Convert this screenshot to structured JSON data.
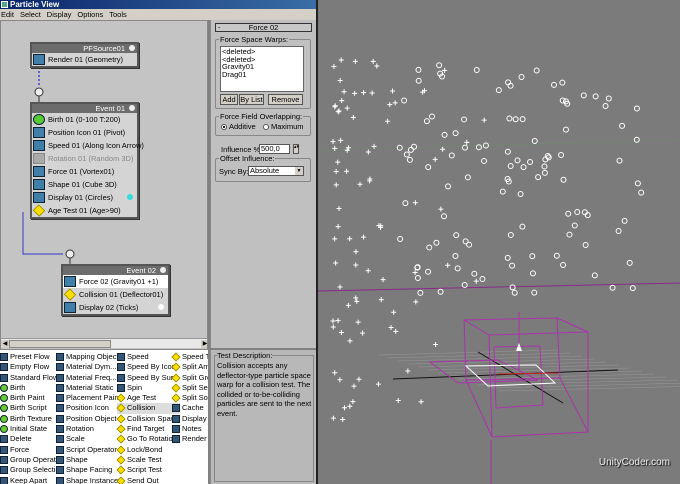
{
  "window": {
    "title": "Particle View"
  },
  "menu": [
    "Edit",
    "Select",
    "Display",
    "Options",
    "Tools"
  ],
  "nodes": {
    "source": {
      "title": "PFSource01",
      "ops": [
        "Render 01 (Geometry)"
      ]
    },
    "event1": {
      "title": "Event 01",
      "ops": [
        "Birth 01 (0-100 T:200)",
        "Position Icon 01 (Pivot)",
        "Speed 01 (Along Icon Arrow)",
        "Rotation 01 (Random 3D)",
        "Force 01 (Vortex01)",
        "Shape 01 (Cube 3D)",
        "Display 01 (Circles)",
        "Age Test 01 (Age>90)"
      ],
      "display_color": "#33dddd"
    },
    "event2": {
      "title": "Event 02",
      "ops": [
        "Force 02 (Gravity01 +1)",
        "Collision 01 (Deflector01)",
        "Display 02 (Ticks)"
      ],
      "display_color": "#ffffff"
    }
  },
  "params": {
    "rollout_title": "Force 02",
    "warps_label": "Force Space Warps:",
    "warps": [
      "<deleted>",
      "<deleted>",
      "Gravity01",
      "Drag01"
    ],
    "add": "Add",
    "bylist": "By List",
    "remove": "Remove",
    "overlap_label": "Force Field Overlapping:",
    "additive": "Additive",
    "maximum": "Maximum",
    "overlap_selected": "Additive",
    "influence_label": "Influence %",
    "influence_value": "500,0",
    "offset_label": "Offset Influence:",
    "sync_label": "Sync By:",
    "sync_value": "Absolute"
  },
  "depot": [
    [
      "Preset Flow",
      "Empty Flow",
      "Standard Flow",
      "Birth",
      "Birth Paint",
      "Birth Script",
      "Birth Texture",
      "Initial State",
      "Delete",
      "Force",
      "Group Operator",
      "Group Selection",
      "Keep Apart"
    ],
    [
      "Mapping Object",
      "Material Dym...",
      "Material Freq...",
      "Material Static",
      "Placement Paint",
      "Position Icon",
      "Position Object",
      "Rotation",
      "Scale",
      "Script Operator",
      "Shape",
      "Shape Facing",
      "Shape Instance"
    ],
    [
      "Speed",
      "Speed By Icon",
      "Speed By Sur...",
      "Spin",
      "Age Test",
      "Collision",
      "Collision Spawn",
      "Find Target",
      "Go To Rotation",
      "Lock/Bond",
      "Scale Test",
      "Script Test",
      "Send Out"
    ],
    [
      "Speed Te",
      "Split Amo",
      "Split Grou",
      "Split Sele",
      "Split Sou",
      "Cache",
      "Display",
      "Notes",
      "Render"
    ]
  ],
  "depot_selected": "Collision",
  "description": {
    "label": "Test Description:",
    "text": "Collision accepts any deflector-type particle space warp for a collision test. The collided or to-be-colliding particles are sent to the next event."
  },
  "watermark": "UnityCoder.com"
}
